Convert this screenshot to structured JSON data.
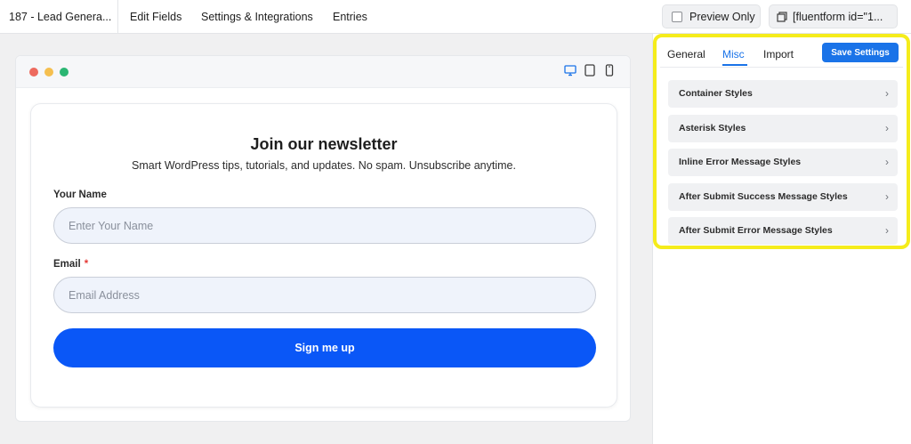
{
  "topbar": {
    "form_title": "187 - Lead Genera...",
    "nav": [
      "Edit Fields",
      "Settings & Integrations",
      "Entries"
    ],
    "preview_label": "Preview Only",
    "shortcode": "[fluentform id=\"1..."
  },
  "preview": {
    "dots": [
      "#ed6a5e",
      "#f5bf4f",
      "#2bb673"
    ],
    "accent": "#1a73e8"
  },
  "form": {
    "heading": "Join our newsletter",
    "subheading": "Smart WordPress tips, tutorials, and updates. No spam. Unsubscribe anytime.",
    "name_label": "Your Name",
    "name_placeholder": "Enter Your Name",
    "email_label": "Email",
    "email_required": "*",
    "email_placeholder": "Email Address",
    "submit_label": "Sign me up",
    "submit_color": "#0a57f7"
  },
  "sidebar": {
    "tabs": [
      "General",
      "Misc",
      "Import"
    ],
    "active_tab": "Misc",
    "save_label": "Save Settings",
    "items": [
      "Container Styles",
      "Asterisk Styles",
      "Inline Error Message Styles",
      "After Submit Success Message Styles",
      "After Submit Error Message Styles"
    ],
    "highlight_color": "#f5ec1b"
  }
}
